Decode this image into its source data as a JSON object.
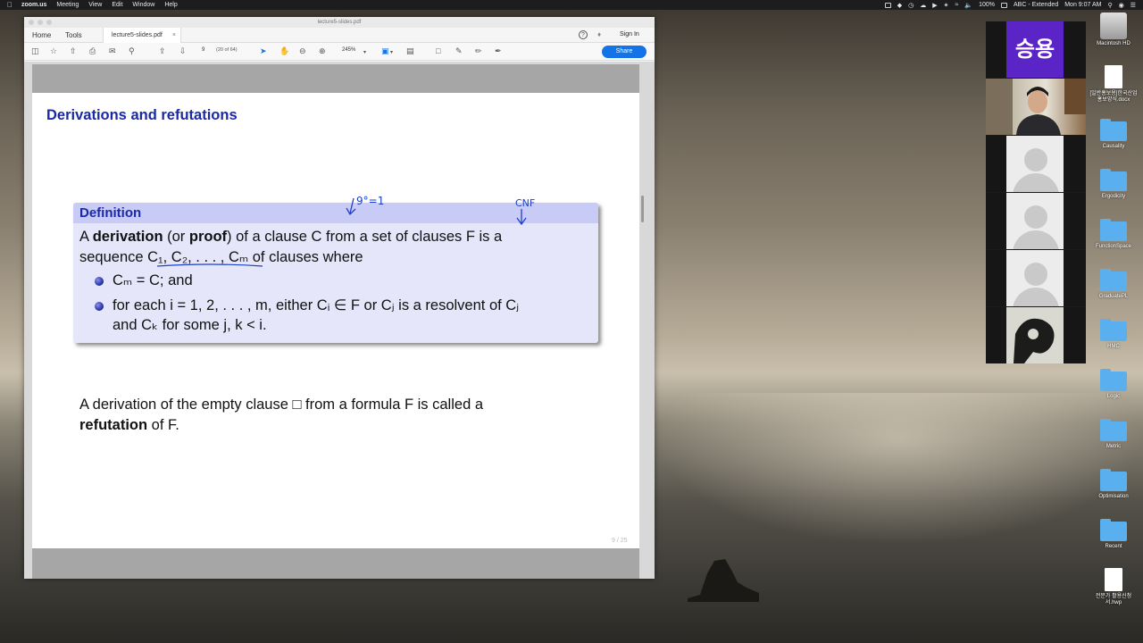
{
  "menubar": {
    "app": "zoom.us",
    "items": [
      "Meeting",
      "View",
      "Edit",
      "Window",
      "Help"
    ],
    "battery": "100%",
    "input_source": "ABC - Extended",
    "clock": "Mon 9:07 AM"
  },
  "acrobat": {
    "window_title": "lecture5-slides.pdf",
    "tabs": {
      "home": "Home",
      "tools": "Tools",
      "document": "lecture5-slides.pdf"
    },
    "sign_in": "Sign In",
    "help": "?",
    "toolbar": {
      "page_number": "9",
      "page_of": "(20 of 64)",
      "zoom": "245%",
      "share": "Share"
    }
  },
  "slide": {
    "title": "Derivations and refutations",
    "definition_header": "Definition",
    "def_line1_pre": "A ",
    "def_line1_b1": "derivation",
    "def_line1_mid": " (or ",
    "def_line1_b2": "proof",
    "def_line1_post": ") of a clause C from a set of clauses F is a",
    "def_line2": "sequence C₁, C₂, . . . , Cₘ of clauses where",
    "bullet1": "Cₘ = C; and",
    "bullet2_line1": "for each i = 1, 2, . . . , m, either Cᵢ ∈ F or Cⱼ is a resolvent of Cⱼ",
    "bullet2_line2": "and Cₖ for some j, k < i.",
    "refutation_line1": "A derivation of the empty clause □ from a formula F is called a",
    "refutation_bold": "refutation",
    "refutation_post": " of F.",
    "page_counter": "9 / 25",
    "annotations": {
      "anno1": "9°=1",
      "anno2": "CNF"
    }
  },
  "zoom_gallery": {
    "name_tile": "승용"
  },
  "desktop_icons": [
    {
      "label": "Macintosh HD",
      "icon": "hard-drive-icon"
    },
    {
      "label": "[일반홍보용]한국산업홍보양식.docx",
      "icon": "document-icon"
    },
    {
      "label": "Causality",
      "icon": "folder-icon"
    },
    {
      "label": "Ergodicity",
      "icon": "folder-icon"
    },
    {
      "label": "FunctionSpace",
      "icon": "folder-icon"
    },
    {
      "label": "GraduatePL",
      "icon": "folder-icon"
    },
    {
      "label": "HMC",
      "icon": "folder-icon"
    },
    {
      "label": "Logic",
      "icon": "folder-icon"
    },
    {
      "label": "Metric",
      "icon": "folder-icon"
    },
    {
      "label": "Optimisation",
      "icon": "folder-icon"
    },
    {
      "label": "Recent",
      "icon": "folder-icon"
    },
    {
      "label": "전문가 활용신청서.hwp",
      "icon": "document-icon"
    }
  ]
}
